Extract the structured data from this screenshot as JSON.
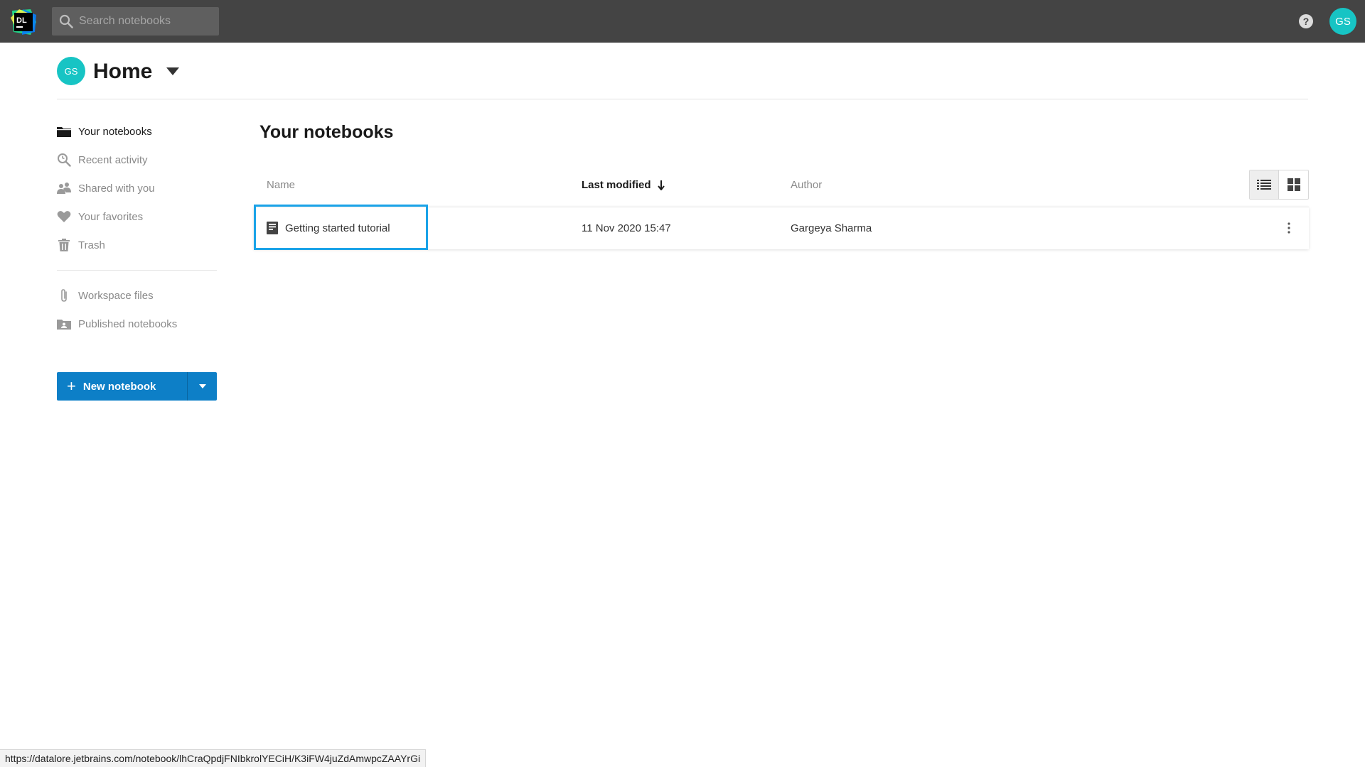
{
  "topbar": {
    "logo_text": "DL",
    "search": {
      "placeholder": "Search notebooks",
      "value": ""
    },
    "help_icon": "help-circle-icon",
    "avatar_initials": "GS"
  },
  "header": {
    "avatar_initials": "GS",
    "title": "Home"
  },
  "sidebar": {
    "items": [
      {
        "label": "Your notebooks",
        "icon": "folder-icon",
        "active": true
      },
      {
        "label": "Recent activity",
        "icon": "magnifier-clock-icon",
        "active": false
      },
      {
        "label": "Shared with you",
        "icon": "people-icon",
        "active": false
      },
      {
        "label": "Your favorites",
        "icon": "heart-icon",
        "active": false
      },
      {
        "label": "Trash",
        "icon": "trash-icon",
        "active": false
      }
    ],
    "secondary_items": [
      {
        "label": "Workspace files",
        "icon": "paperclip-icon"
      },
      {
        "label": "Published notebooks",
        "icon": "published-folder-icon"
      }
    ],
    "new_button_label": "New notebook"
  },
  "main": {
    "title": "Your notebooks",
    "columns": {
      "name": "Name",
      "last_modified": "Last modified",
      "author": "Author"
    },
    "sort_column": "last_modified",
    "sort_direction": "descending",
    "view_mode": "list",
    "rows": [
      {
        "name": "Getting started tutorial",
        "last_modified": "11 Nov 2020 15:47",
        "author": "Gargeya Sharma"
      }
    ]
  },
  "status_bar": {
    "url": "https://datalore.jetbrains.com/notebook/lhCraQpdjFNIbkrolYECiH/K3iFW4juZdAmwpcZAAYrGi"
  },
  "colors": {
    "topbar": "#444444",
    "accent": "#0d7fc7",
    "avatar": "#17c4c4",
    "highlight": "#1aa3e8"
  }
}
